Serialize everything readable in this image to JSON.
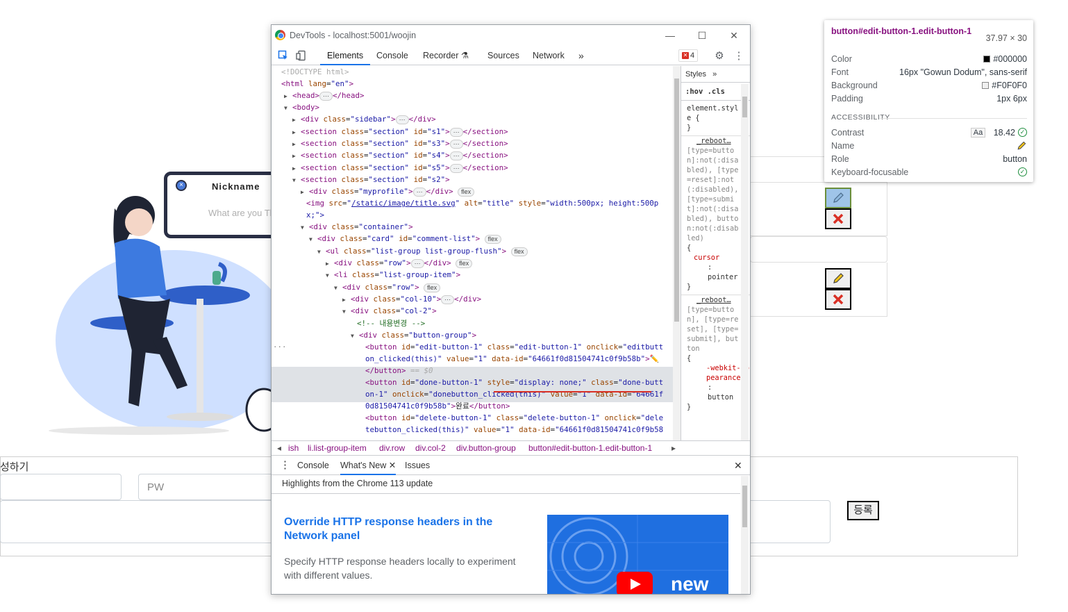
{
  "background_page": {
    "nickname_title": "Nickname",
    "nickname_placeholder": "What are you Thinking about",
    "write_label": "성하기",
    "pw_placeholder": "PW",
    "register_button": "등록"
  },
  "tooltip": {
    "selector": "button#edit-button-1.edit-button-1",
    "size": "37.97 × 30",
    "color_label": "Color",
    "color_value": "#000000",
    "font_label": "Font",
    "font_value": "16px \"Gowun Dodum\", sans-serif",
    "background_label": "Background",
    "background_value": "#F0F0F0",
    "padding_label": "Padding",
    "padding_value": "1px 6px",
    "accessibility_heading": "ACCESSIBILITY",
    "contrast_label": "Contrast",
    "contrast_aa": "Aa",
    "contrast_value": "18.42",
    "name_label": "Name",
    "role_label": "Role",
    "role_value": "button",
    "focus_label": "Keyboard-focusable",
    "colors": {
      "text": "#000000",
      "background": "#F0F0F0"
    }
  },
  "devtools": {
    "window_title": "DevTools - localhost:5001/woojin",
    "tabs": [
      "Elements",
      "Console",
      "Recorder",
      "Sources",
      "Network"
    ],
    "error_count": "4",
    "styles_tab": "Styles",
    "styles_filter": ":hov  .cls",
    "styles_rules": {
      "element_style": "element.style {",
      "close_brace": "}",
      "reboot1_src": "_reboot…",
      "reboot1_selector": "[type=button]:not(:disabled), [type=reset]:not(:disabled), [type=submit]:not(:disabled), button:not(:disabled)",
      "reboot1_prop": "cursor",
      "reboot1_val": "pointer",
      "reboot2_src": "_reboot…",
      "reboot2_selector": "[type=button], [type=reset], [type=submit], button",
      "reboot2_prop": "-webkit-appearance",
      "reboot2_val": "button"
    },
    "breadcrumbs": [
      "ish",
      "li.list-group-item",
      "div.row",
      "div.col-2",
      "div.button-group",
      "button#edit-button-1.edit-button-1"
    ],
    "drawer_tabs": [
      "Console",
      "What's New",
      "Issues"
    ],
    "whats_new": {
      "highlights": "Highlights from the Chrome 113 update",
      "title": "Override HTTP response headers in the Network panel",
      "text": "Specify HTTP response headers locally to experiment with different values.",
      "image_label": "new"
    },
    "dom": {
      "l1": "<!DOCTYPE html>",
      "l2_tag": "<html ",
      "l2_attr": "lang",
      "l2_val": "\"en\"",
      "head": "<head>",
      "head_close": "</head>",
      "body": "<body>",
      "sidebar_class": "\"sidebar\"",
      "s1": "\"s1\"",
      "s3": "\"s3\"",
      "s4": "\"s4\"",
      "s5": "\"s5\"",
      "s2": "\"s2\"",
      "section_class": "\"section\"",
      "myprofile": "\"myprofile\"",
      "img_src": "/static/image/title.svg",
      "img_alt": "\"title\"",
      "img_style": "\"width:500px; height:500p",
      "img_style2": "x;\">",
      "container": "\"container\"",
      "card": "\"card\"",
      "comment_list": "\"comment-list\"",
      "ul_class": "\"list-group list-group-flush\"",
      "row": "\"row\"",
      "li_class": "\"list-group-item\"",
      "col10": "\"col-10\"",
      "col2": "\"col-2\"",
      "comment": "<!-- 내용변경 -->",
      "button_group": "\"button-group\"",
      "edit_id": "\"edit-button-1\"",
      "edit_class": "\"edit-button-1\"",
      "edit_onclick": "\"editbutt",
      "edit_onclick2": "on_clicked(this)\"",
      "edit_value": "\"1\"",
      "edit_dataid": "\"64661f0d81504741c0f9b58b\"",
      "eq": "== $0",
      "done_line1a": "<button ",
      "done_id": "\"done-button-1\"",
      "done_style": "\"display: none;\"",
      "done_class": "\"done-butt",
      "done_line2": "on-1\"",
      "done_onclick": "\"donebutton_clicked(this)\"",
      "done_value": "\"1\"",
      "done_dataid": "\"64661f",
      "done_line3": "0d81504741c0f9b58b\"",
      "done_text": "완료",
      "del_id": "\"delete-button-1\"",
      "del_class": "\"delete-button-1\"",
      "del_onclick": "\"dele",
      "del_line2": "tebutton_clicked(this)\"",
      "del_value": "\"1\"",
      "del_dataid": "\"64661f0d81504741c0f9b58"
    },
    "flex_badge": "flex"
  }
}
